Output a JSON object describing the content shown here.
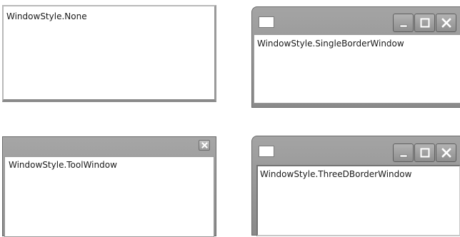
{
  "windows": {
    "none": {
      "label": "WindowStyle.None"
    },
    "single_border": {
      "label": "WindowStyle.SingleBorderWindow"
    },
    "tool": {
      "label": "WindowStyle.ToolWindow"
    },
    "three_d_border": {
      "label": "WindowStyle.ThreeDBorderWindow"
    }
  },
  "icons": {
    "system": "app-icon",
    "minimize": "minimize-icon",
    "maximize": "maximize-icon",
    "close": "close-icon"
  },
  "colors": {
    "frame": "#8f8f8f",
    "client": "#ffffff",
    "text": "#1a1a1a"
  }
}
